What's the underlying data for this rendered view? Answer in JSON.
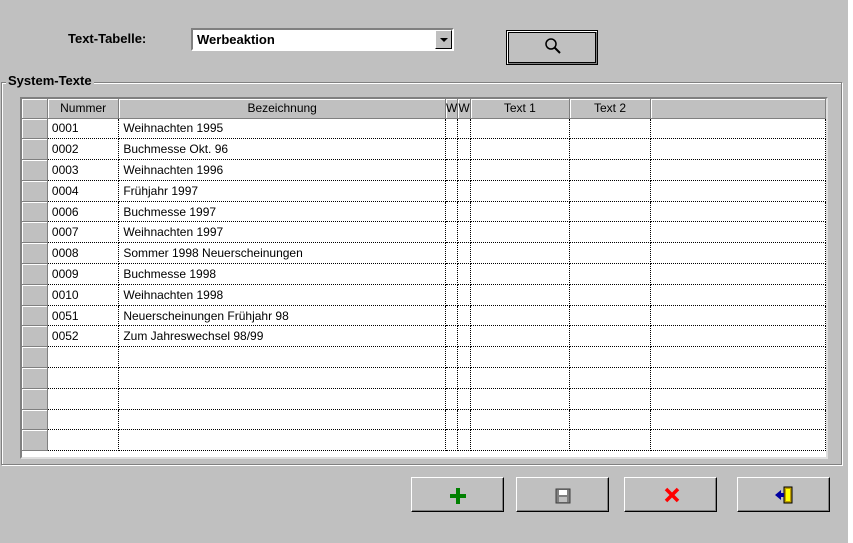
{
  "header": {
    "text_tabelle_label": "Text-Tabelle:",
    "combo_value": "Werbeaktion",
    "search_icon": "magnifier-icon"
  },
  "group": {
    "title": "System-Texte"
  },
  "grid": {
    "columns": [
      "Nummer",
      "Bezeichnung",
      "W",
      "W",
      "Text 1",
      "Text 2",
      ""
    ],
    "rows": [
      [
        "0001",
        "Weihnachten 1995",
        "",
        "",
        "",
        "",
        ""
      ],
      [
        "0002",
        "Buchmesse Okt. 96",
        "",
        "",
        "",
        "",
        ""
      ],
      [
        "0003",
        "Weihnachten 1996",
        "",
        "",
        "",
        "",
        ""
      ],
      [
        "0004",
        "Frühjahr 1997",
        "",
        "",
        "",
        "",
        ""
      ],
      [
        "0006",
        "Buchmesse 1997",
        "",
        "",
        "",
        "",
        ""
      ],
      [
        "0007",
        "Weihnachten 1997",
        "",
        "",
        "",
        "",
        ""
      ],
      [
        "0008",
        "Sommer 1998 Neuerscheinungen",
        "",
        "",
        "",
        "",
        ""
      ],
      [
        "0009",
        "Buchmesse 1998",
        "",
        "",
        "",
        "",
        ""
      ],
      [
        "0010",
        "Weihnachten 1998",
        "",
        "",
        "",
        "",
        ""
      ],
      [
        "0051",
        "Neuerscheinungen Frühjahr 98",
        "",
        "",
        "",
        "",
        ""
      ],
      [
        "0052",
        "Zum Jahreswechsel 98/99",
        "",
        "",
        "",
        "",
        ""
      ],
      [
        "",
        "",
        "",
        "",
        "",
        "",
        ""
      ],
      [
        "",
        "",
        "",
        "",
        "",
        "",
        ""
      ],
      [
        "",
        "",
        "",
        "",
        "",
        "",
        ""
      ],
      [
        "",
        "",
        "",
        "",
        "",
        "",
        ""
      ],
      [
        "",
        "",
        "",
        "",
        "",
        "",
        ""
      ]
    ]
  },
  "buttons": {
    "add_icon": "plus-icon",
    "save_icon": "floppy-disk-icon",
    "delete_icon": "red-x-icon",
    "exit_icon": "exit-door-icon",
    "colors": {
      "add": "#008000",
      "delete": "#ff0000",
      "face": "#c0c0c0"
    }
  }
}
